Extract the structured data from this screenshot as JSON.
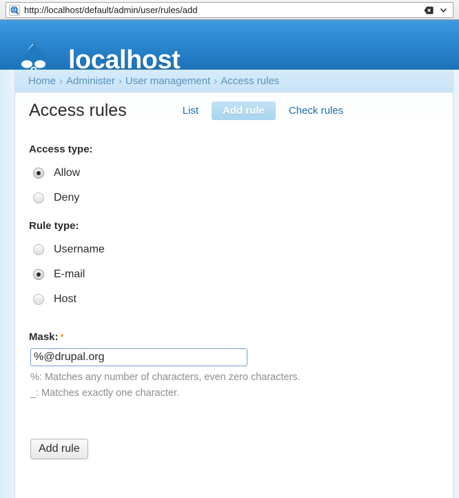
{
  "browser": {
    "url": "http://localhost/default/admin/user/rules/add",
    "favicon_name": "globe-favicon-icon",
    "clear_label": "",
    "dropdown_label": ""
  },
  "header": {
    "site_name": "localhost",
    "logo_name": "drupal-droplet-logo"
  },
  "breadcrumb": {
    "items": [
      {
        "label": "Home"
      },
      {
        "label": "Administer"
      },
      {
        "label": "User management"
      },
      {
        "label": "Access rules"
      }
    ],
    "separator": "›"
  },
  "main": {
    "title": "Access rules",
    "tabs": [
      {
        "label": "List",
        "active": false
      },
      {
        "label": "Add rule",
        "active": true
      },
      {
        "label": "Check rules",
        "active": false
      }
    ]
  },
  "form": {
    "access_type": {
      "legend": "Access type:",
      "options": [
        {
          "label": "Allow",
          "selected": true
        },
        {
          "label": "Deny",
          "selected": false
        }
      ]
    },
    "rule_type": {
      "legend": "Rule type:",
      "options": [
        {
          "label": "Username",
          "selected": false
        },
        {
          "label": "E-mail",
          "selected": true
        },
        {
          "label": "Host",
          "selected": false
        }
      ]
    },
    "mask": {
      "label": "Mask:",
      "required_marker": "*",
      "value": "%@drupal.org",
      "placeholder": "",
      "help": [
        "%: Matches any number of characters, even zero characters.",
        "_: Matches exactly one character."
      ]
    },
    "submit_label": "Add rule"
  },
  "colors": {
    "header_blue": "#2a86cf",
    "link_blue": "#1a6fb5",
    "breadcrumb_bg": "#d0e7f8",
    "required_star": "#e8a33d",
    "input_border": "#6f9fd0"
  }
}
